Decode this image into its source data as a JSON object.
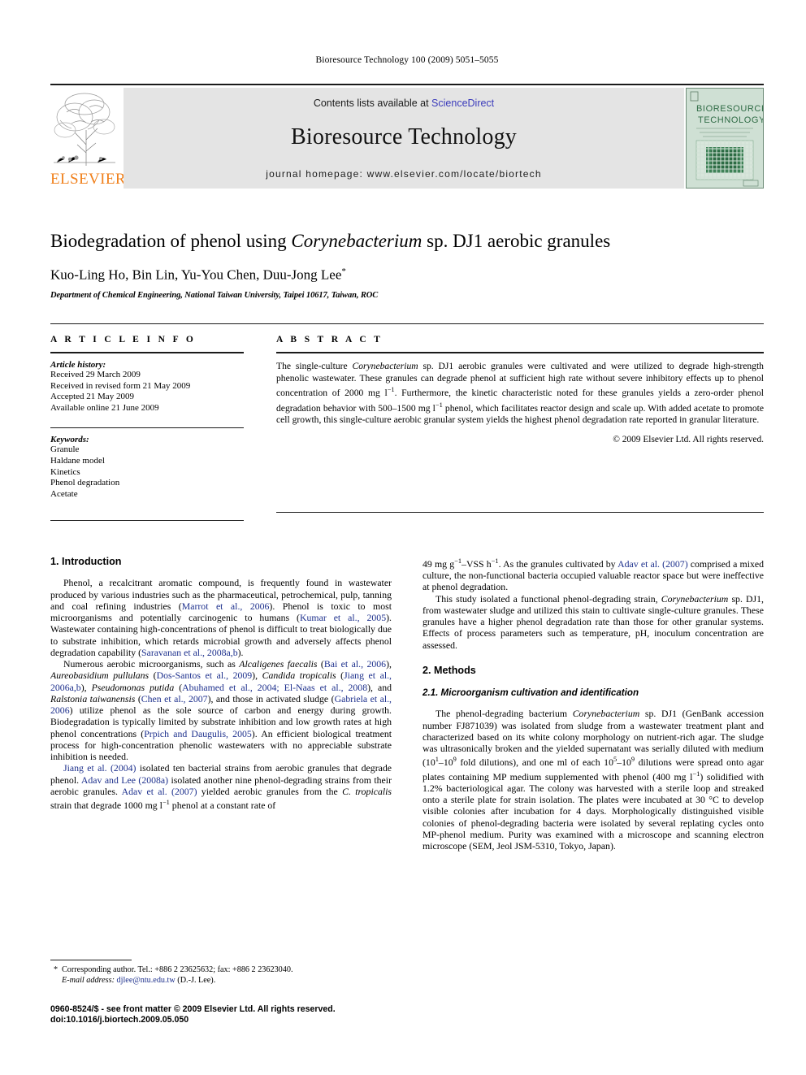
{
  "running_head": "Bioresource Technology 100 (2009) 5051–5055",
  "masthead": {
    "contents_prefix": "Contents lists available at ",
    "sciencedirect": "ScienceDirect",
    "journal_title": "Bioresource Technology",
    "homepage": "journal homepage: www.elsevier.com/locate/biortech",
    "publisher": "ELSEVIER",
    "cover_line1": "BIORESOURCE",
    "cover_line2": "TECHNOLOGY",
    "band_color": "#e4e4e4",
    "link_color": "#3b3bbb",
    "publisher_color": "#f07f1a",
    "cover_color": "#cfe0d4"
  },
  "title": {
    "part1": "Biodegradation of phenol using ",
    "italic": "Corynebacterium",
    "part2": " sp. DJ1 aerobic granules"
  },
  "authors": "Kuo-Ling Ho, Bin Lin, Yu-You Chen, Duu-Jong Lee",
  "author_marker": "*",
  "affiliation": "Department of Chemical Engineering, National Taiwan University, Taipei 10617, Taiwan, ROC",
  "article_info": {
    "heading": "A R T I C L E   I N F O",
    "history_label": "Article history:",
    "history": [
      "Received 29 March 2009",
      "Received in revised form 21 May 2009",
      "Accepted 21 May 2009",
      "Available online 21 June 2009"
    ],
    "keywords_label": "Keywords:",
    "keywords": [
      "Granule",
      "Haldane model",
      "Kinetics",
      "Phenol degradation",
      "Acetate"
    ]
  },
  "abstract": {
    "heading": "A B S T R A C T",
    "text_a": "The single-culture ",
    "text_italic": "Corynebacterium",
    "text_b": " sp. DJ1 aerobic granules were cultivated and were utilized to degrade high-strength phenolic wastewater. These granules can degrade phenol at sufficient high rate without severe inhibitory effects up to phenol concentration of 2000 mg l",
    "sup1": "−1",
    "text_c": ". Furthermore, the kinetic characteristic noted for these granules yields a zero-order phenol degradation behavior with 500–1500 mg l",
    "sup2": "−1",
    "text_d": " phenol, which facilitates reactor design and scale up. With added acetate to promote cell growth, this single-culture aerobic granular system yields the highest phenol degradation rate reported in granular literature.",
    "copyright": "© 2009 Elsevier Ltd. All rights reserved."
  },
  "sections": {
    "introduction_heading": "1. Introduction",
    "methods_heading": "2. Methods",
    "methods_sub_heading": "2.1. Microorganism cultivation and identification"
  },
  "intro": {
    "p1_a": "Phenol, a recalcitrant aromatic compound, is frequently found in wastewater produced by various industries such as the pharmaceutical, petrochemical, pulp, tanning and coal refining industries (",
    "p1_ref1": "Marrot et al., 2006",
    "p1_b": "). Phenol is toxic to most microorganisms and potentially carcinogenic to humans (",
    "p1_ref2": "Kumar et al., 2005",
    "p1_c": "). Wastewater containing high-concentrations of phenol is difficult to treat biologically due to substrate inhibition, which retards microbial growth and adversely affects phenol degradation capability (",
    "p1_ref3": "Saravanan et al., 2008a,b",
    "p1_d": ").",
    "p2_a": "Numerous aerobic microorganisms, such as ",
    "p2_sp1": "Alcaligenes faecalis",
    "p2_b": " (",
    "p2_ref1": "Bai et al., 2006",
    "p2_c": "), ",
    "p2_sp2": "Aureobasidium pullulans",
    "p2_d": " (",
    "p2_ref2": "Dos-Santos et al., 2009",
    "p2_e": "), ",
    "p2_sp3": "Candida tropicalis",
    "p2_f": " (",
    "p2_ref3": "Jiang et al., 2006a,b",
    "p2_g": "), ",
    "p2_sp4": "Pseudomonas putida",
    "p2_h": " (",
    "p2_ref4": "Abuhamed et al., 2004; El-Naas et al., 2008",
    "p2_i": "), and ",
    "p2_sp5": "Ralstonia taiwanensis",
    "p2_j": " (",
    "p2_ref5": "Chen et al., 2007",
    "p2_k": "), and those in activated sludge (",
    "p2_ref6": "Gabriela et al., 2006",
    "p2_l": ") utilize phenol as the sole source of carbon and energy during growth. Biodegradation is typically limited by substrate inhibition and low growth rates at high phenol concentrations (",
    "p2_ref7": "Prpich and Daugulis, 2005",
    "p2_m": "). An efficient biological treatment process for high-concentration phenolic wastewaters with no appreciable substrate inhibition is needed.",
    "p3_ref1": "Jiang et al. (2004)",
    "p3_a": " isolated ten bacterial strains from aerobic granules that degrade phenol. ",
    "p3_ref2": "Adav and Lee (2008a)",
    "p3_b": " isolated another nine phenol-degrading strains from their aerobic granules. ",
    "p3_ref3": "Adav et al. (2007)",
    "p3_c": " yielded aerobic granules from the ",
    "p3_sp": "C. tropicalis",
    "p3_d": " strain that degrade 1000 mg l",
    "p3_sup": "−1",
    "p3_e": " phenol at a constant rate of ",
    "p3_cont_a": "49 mg g",
    "p3_cont_sup1": "−1",
    "p3_cont_b": "–VSS h",
    "p3_cont_sup2": "−1",
    "p3_cont_c": ". As the granules cultivated by ",
    "p3_cont_ref": "Adav et al. (2007)",
    "p3_cont_d": " comprised a mixed culture, the non-functional bacteria occupied valuable reactor space but were ineffective at phenol degradation.",
    "p4_a": "This study isolated a functional phenol-degrading strain, ",
    "p4_sp": "Corynebacterium",
    "p4_b": " sp. DJ1, from wastewater sludge and utilized this stain to cultivate single-culture granules. These granules have a higher phenol degradation rate than those for other granular systems. Effects of process parameters such as temperature, pH, inoculum concentration are assessed."
  },
  "methods": {
    "p1_a": "The phenol-degrading bacterium ",
    "p1_sp": "Corynebacterium",
    "p1_b": " sp. DJ1 (GenBank accession number FJ871039) was isolated from sludge from a wastewater treatment plant and characterized based on its white colony morphology on nutrient-rich agar. The sludge was ultrasonically broken and the yielded supernatant was serially diluted with medium (10",
    "p1_sup1": "1",
    "p1_c": "–10",
    "p1_sup2": "9",
    "p1_d": " fold dilutions), and one ml of each 10",
    "p1_sup3": "5",
    "p1_e": "–10",
    "p1_sup4": "9",
    "p1_f": " dilutions were spread onto agar plates containing MP medium supplemented with phenol (400 mg l",
    "p1_sup5": "−1",
    "p1_g": ") solidified with 1.2% bacteriological agar. The colony was harvested with a sterile loop and streaked onto a sterile plate for strain isolation. The plates were incubated at 30 °C to develop visible colonies after incubation for 4 days. Morphologically distinguished visible colonies of phenol-degrading bacteria were isolated by several replating cycles onto MP-phenol medium. Purity was examined with a microscope and scanning electron microscope (SEM, Jeol JSM-5310, Tokyo, Japan)."
  },
  "footnote": {
    "marker": "*",
    "corresponding": "Corresponding author. Tel.: +886 2 23625632; fax: +886 2 23623040.",
    "email_label": "E-mail address:",
    "email": "djlee@ntu.edu.tw",
    "email_suffix": "(D.-J. Lee)."
  },
  "imprint": {
    "line1": "0960-8524/$ - see front matter © 2009 Elsevier Ltd. All rights reserved.",
    "line2": "doi:10.1016/j.biortech.2009.05.050"
  }
}
